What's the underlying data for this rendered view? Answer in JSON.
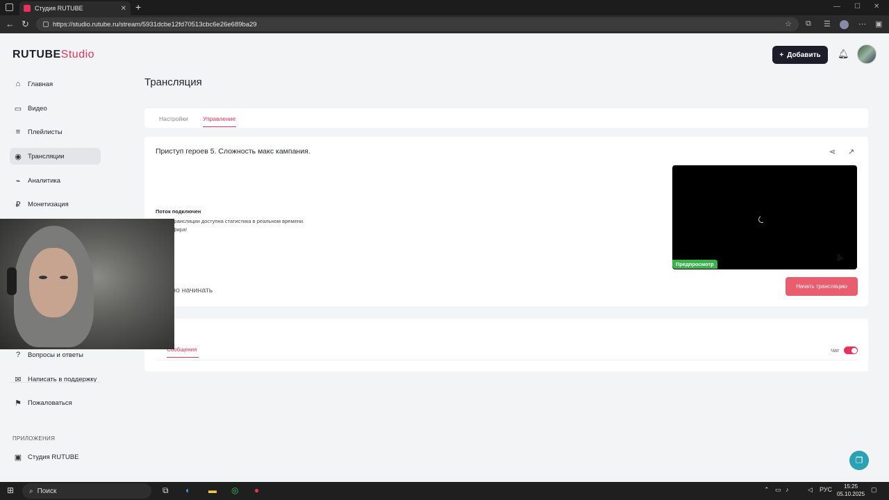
{
  "browser": {
    "tab_title": "Студия RUTUBE",
    "url": "https://studio.rutube.ru/stream/5931dcbe12fd70513cbc6e26e689ba29"
  },
  "header": {
    "logo_main": "RUTUBE",
    "logo_studio": "Studio",
    "add_button": "Добавить"
  },
  "sidebar": {
    "items": [
      {
        "label": "Главная",
        "icon": "home-icon"
      },
      {
        "label": "Видео",
        "icon": "video-icon"
      },
      {
        "label": "Плейлисты",
        "icon": "playlist-icon"
      },
      {
        "label": "Трансляции",
        "icon": "broadcast-icon",
        "active": true
      },
      {
        "label": "Аналитика",
        "icon": "analytics-icon"
      },
      {
        "label": "Монетизация",
        "icon": "ruble-icon"
      },
      {
        "label": "Вопросы и ответы",
        "icon": "question-icon"
      },
      {
        "label": "Написать в поддержку",
        "icon": "mail-icon"
      },
      {
        "label": "Пожаловаться",
        "icon": "flag-icon"
      }
    ],
    "apps_section": "ПРИЛОЖЕНИЯ",
    "apps": [
      {
        "label": "Студия RUTUBE",
        "icon": "studio-app-icon"
      }
    ]
  },
  "main": {
    "page_title": "Трансляция",
    "tabs": [
      {
        "label": "Настройки",
        "active": false
      },
      {
        "label": "Управление",
        "active": true
      }
    ],
    "stream_title": "Приступ героев 5. Сложность макс кампания.",
    "status_title": "Поток подключен",
    "status_line1": "…емя трансляции доступна статистика в реальном времени.",
    "status_line2": "…его эфира!",
    "can_start": "…ожно начинать",
    "preview_badge": "Предпросмотр",
    "start_button": "Начать трансляцию",
    "chat_tab": "Сообщения",
    "chat_toggle_label": "Чат",
    "chat_toggle_on": true
  },
  "taskbar": {
    "search": "Поиск",
    "lang": "РУС",
    "time": "15:25",
    "date": "05.10.2025"
  },
  "colors": {
    "accent": "#e8315b",
    "start_button": "#ea5d6e",
    "preview_badge": "#3cb34a",
    "dark_button": "#1b1d2a"
  }
}
